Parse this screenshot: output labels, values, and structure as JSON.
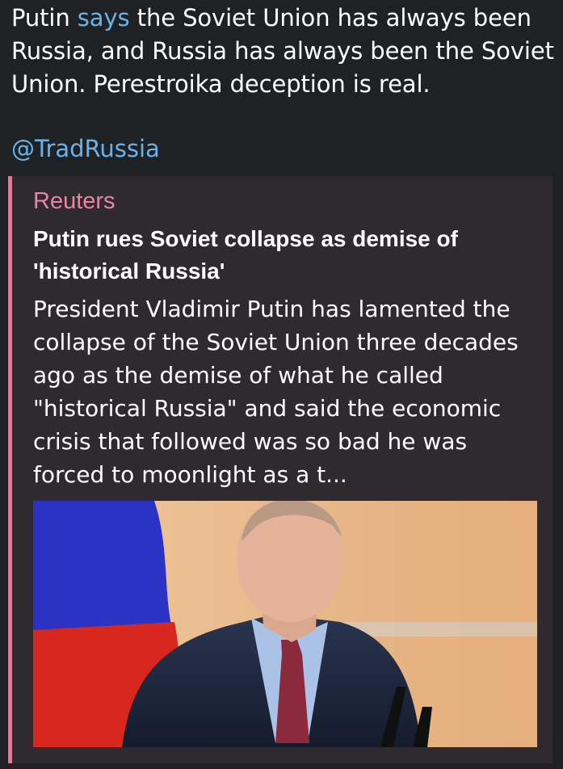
{
  "post": {
    "text_before_link": "Putin ",
    "link_text": "says",
    "text_after_link": " the Soviet Union has always been Russia, and Russia has always been the Soviet Union. Perestroika deception is real.",
    "handle": "@TradRussia"
  },
  "link_preview": {
    "site_name": "Reuters",
    "title": "Putin rues Soviet collapse as demise of 'historical Russia'",
    "description": "President Vladimir Putin has lamented the collapse of the Soviet Union three decades ago as the demise of what he called \"historical Russia\" and said the economic crisis that followed was so bad he was forced to moonlight as a t..."
  },
  "colors": {
    "background": "#1e2225",
    "link": "#6bb2e8",
    "preview_background": "#2f2a30",
    "preview_accent": "#e07a9b",
    "site_name": "#e9869f"
  }
}
